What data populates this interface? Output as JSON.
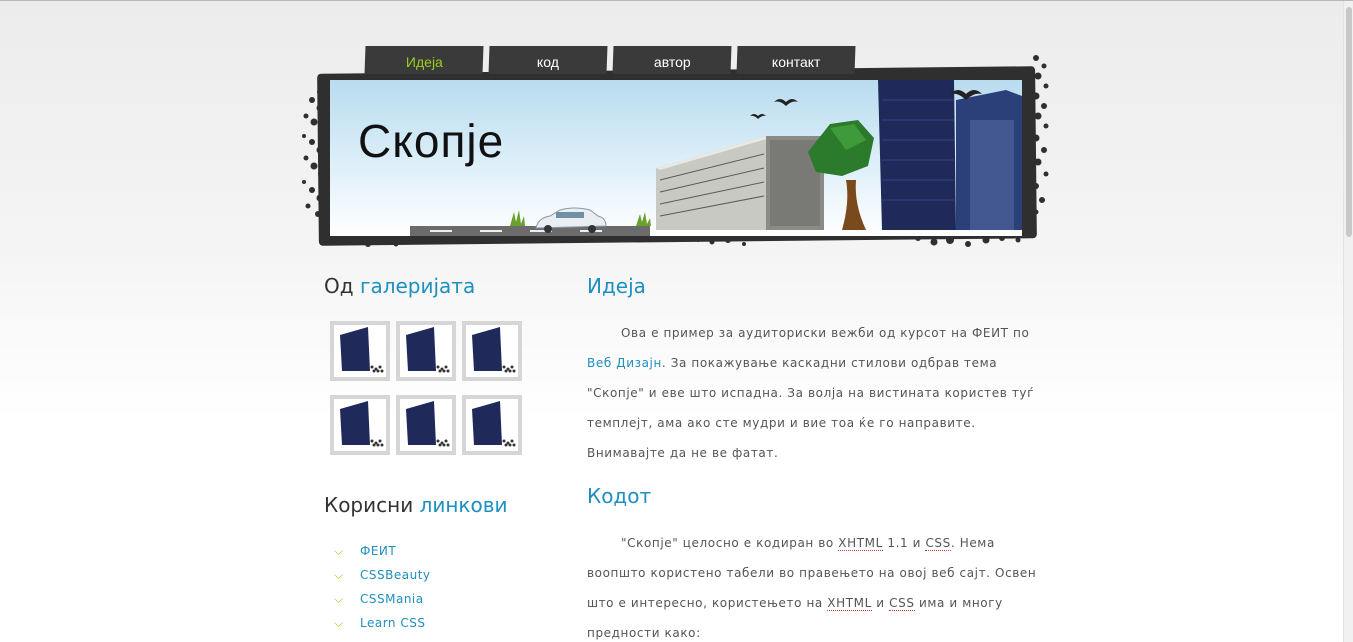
{
  "nav": {
    "tabs": [
      {
        "label": "Идеја",
        "active": true
      },
      {
        "label": "код",
        "active": false
      },
      {
        "label": "автор",
        "active": false
      },
      {
        "label": "контакт",
        "active": false
      }
    ]
  },
  "header": {
    "site_title": "Скопје"
  },
  "sidebar": {
    "gallery_heading": {
      "plain": "Од ",
      "highlight": "галеријата"
    },
    "gallery_count": 6,
    "links_heading": {
      "plain": "Корисни ",
      "highlight": "линкови"
    },
    "links": [
      "ФЕИТ",
      "CSSBeauty",
      "CSSMania",
      "Learn CSS"
    ]
  },
  "main": {
    "section1": {
      "heading": "Идеја",
      "p1_a": "Ова е пример за аудиториски вежби од курсот на ФЕИТ по ",
      "p1_link": "Веб Дизајн",
      "p1_b": ". За покажување каскадни стилови одбрав тема \"Скопје\" и еве што испадна. За волја на вистината користев туѓ темплејт, ама ако сте мудри и вие тоа ќе го направите. Внимавајте да не ве фатат."
    },
    "section2": {
      "heading": "Кодот",
      "p_a": "\"Скопје\" целосно е кодиран во ",
      "abbr1": "XHTML",
      "p_b": " 1.1 и ",
      "abbr2": "CSS",
      "p_c": ". Нема воопшто користено табели во правењето на овој веб сајт. Освен што е интересно, користењето на ",
      "abbr3": "XHTML",
      "p_d": " и ",
      "abbr4": "CSS",
      "p_e": " има и многу предности како:"
    }
  },
  "colors": {
    "accent": "#1f8fbf",
    "active_tab": "#9acd1e",
    "tab_bg": "#3a3a3a"
  }
}
